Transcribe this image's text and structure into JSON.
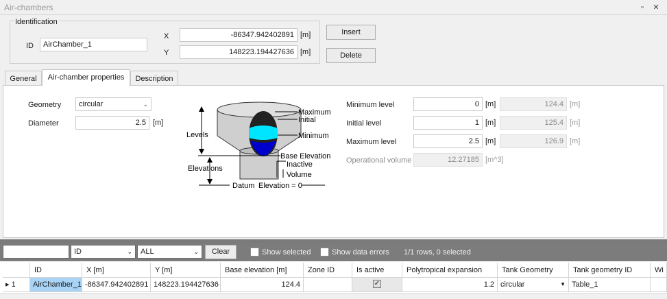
{
  "window": {
    "title": "Air-chambers"
  },
  "identification": {
    "group_label": "Identification",
    "id_label": "ID",
    "id_value": "AirChamber_1",
    "x_label": "X",
    "x_value": "-86347.942402891",
    "y_label": "Y",
    "y_value": "148223.194427636",
    "unit": "[m]"
  },
  "buttons": {
    "insert": "Insert",
    "delete": "Delete"
  },
  "tabs": [
    {
      "label": "General",
      "active": false
    },
    {
      "label": "Air-chamber properties",
      "active": true
    },
    {
      "label": "Description",
      "active": false
    }
  ],
  "properties": {
    "geometry_label": "Geometry",
    "geometry_value": "circular",
    "diameter_label": "Diameter",
    "diameter_value": "2.5",
    "unit_m": "[m]",
    "minimum_level_label": "Minimum level",
    "minimum_level_value": "0",
    "minimum_level_abs": "124.4",
    "initial_level_label": "Initial level",
    "initial_level_value": "1",
    "initial_level_abs": "125.4",
    "maximum_level_label": "Maximum level",
    "maximum_level_value": "2.5",
    "maximum_level_abs": "126.9",
    "operational_volume_label": "Operational volume",
    "operational_volume_value": "12.27185",
    "unit_m3": "[m^3]"
  },
  "diagram": {
    "maximum": "Maximum",
    "initial": "Initial",
    "minimum": "Minimum",
    "levels": "Levels",
    "base_elevation": "Base Elevation",
    "inactive": "Inactive",
    "volume": "Volume",
    "elevations": "Elevations",
    "datum": "Datum",
    "elevation_zero": "Elevation = 0",
    "colors": {
      "water": "#00e5ff",
      "inactive": "#0000cc",
      "tank": "#c8c8c8"
    }
  },
  "filter": {
    "search_value": "",
    "field_select": "ID",
    "scope_select": "ALL",
    "clear_label": "Clear",
    "show_selected_label": "Show selected",
    "show_errors_label": "Show data errors",
    "status": "1/1 rows, 0 selected"
  },
  "table": {
    "columns": [
      "",
      "ID",
      "X [m]",
      "Y [m]",
      "Base elevation [m]",
      "Zone ID",
      "Is active",
      "Polytropical expansion",
      "Tank Geometry",
      "Tank geometry ID",
      "Wi"
    ],
    "rows": [
      {
        "row_number": "1",
        "id": "AirChamber_1",
        "x": "-86347.942402891",
        "y": "148223.194427636",
        "base_elevation": "124.4",
        "zone_id": "",
        "is_active": true,
        "polytropical_expansion": "1.2",
        "tank_geometry": "circular",
        "tank_geometry_id": "Table_1"
      }
    ]
  }
}
